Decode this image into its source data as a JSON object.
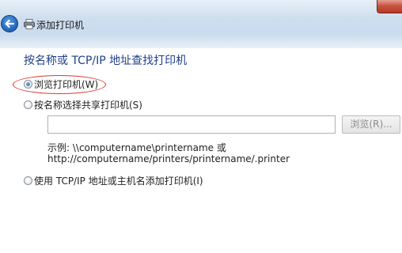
{
  "window": {
    "title": "添加打印机",
    "colors": {
      "accent": "#1e3f8c",
      "highlight": "#d83a32"
    }
  },
  "page": {
    "heading": "按名称或 TCP/IP 地址查找打印机",
    "options": [
      {
        "label": "浏览打印机(W)",
        "selected": true
      },
      {
        "label": "按名称选择共享打印机(S)",
        "selected": false
      },
      {
        "label": "使用 TCP/IP 地址或主机名添加打印机(I)",
        "selected": false
      }
    ],
    "share_input": {
      "value": "",
      "placeholder": ""
    },
    "browse_label": "浏览(R)...",
    "example_line1": "示例: \\\\computername\\printername 或",
    "example_line2": "http://computername/printers/printername/.printer"
  }
}
